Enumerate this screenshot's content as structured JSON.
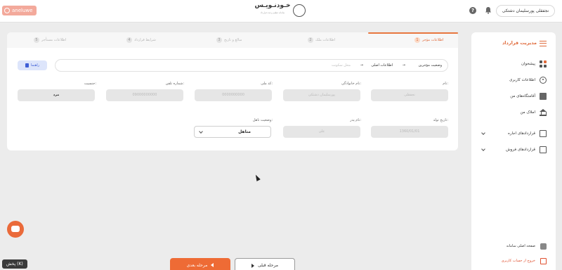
{
  "recording": {
    "label": "aneluwe"
  },
  "header": {
    "logo_text": "خـودنـویـس",
    "logo_subtitle": "سامانه تنظیم و ثبت قرارداد",
    "user_name": "نجفقلی پورسلیمان دشتکی"
  },
  "steps": [
    {
      "num": "1",
      "label": "اطلاعات مؤجر"
    },
    {
      "num": "2",
      "label": "اطلاعات ملک"
    },
    {
      "num": "3",
      "label": "مبالغ و تاریخ"
    },
    {
      "num": "4",
      "label": "شرایط قرارداد"
    },
    {
      "num": "5",
      "label": "اطلاعات مستأجر"
    }
  ],
  "help_button": "راهنما",
  "breadcrumb": {
    "status": "وضعیت مؤجرین",
    "sep1": "→",
    "main": "اطلاعات اصلی",
    "sep2": "→",
    "residence": "محل سکونت"
  },
  "form": {
    "name_label": "نام:",
    "name_value": "نجفقلی",
    "family_label": "نام خانوادگی:",
    "family_value": "پورسلیمان دشتکی",
    "national_id_label": "کد ملی:",
    "national_id_value": "0000000000",
    "phone_label": "شماره تلفن:",
    "phone_value": "09000000000",
    "gender_label": "جنسیت:",
    "gender_value": "مرد",
    "birth_label": "تاریخ تولد:",
    "birth_value": "1360/01/01",
    "father_label": "نام پدر:",
    "father_value": "علی",
    "marital_label": "وضعیت تاهل:",
    "marital_value": "متاهل"
  },
  "sidebar": {
    "title": "مدیریت قرارداد",
    "items": [
      {
        "label": "پیشخوان",
        "icon": "dashboard-icon"
      },
      {
        "label": "اطلاعات کاربری",
        "icon": "user-icon"
      },
      {
        "label": "آقامتگاه‌های من",
        "icon": "building-icon"
      },
      {
        "label": "املاک من",
        "icon": "bank-icon"
      },
      {
        "label": "قراردادهای اجاره",
        "icon": "document-icon"
      },
      {
        "label": "قراردادهای فروش",
        "icon": "document-icon"
      }
    ],
    "home_link": "صفحه اصلی سامانه",
    "logout": "خروج از حساب کاربری"
  },
  "footer": {
    "next_label": "مرحله بعدی",
    "prev_label": "مرحله قبلی",
    "play_label": "پخش (K)"
  },
  "colors": {
    "accent": "#ee6b35",
    "help_blue": "#3f5fd6"
  }
}
